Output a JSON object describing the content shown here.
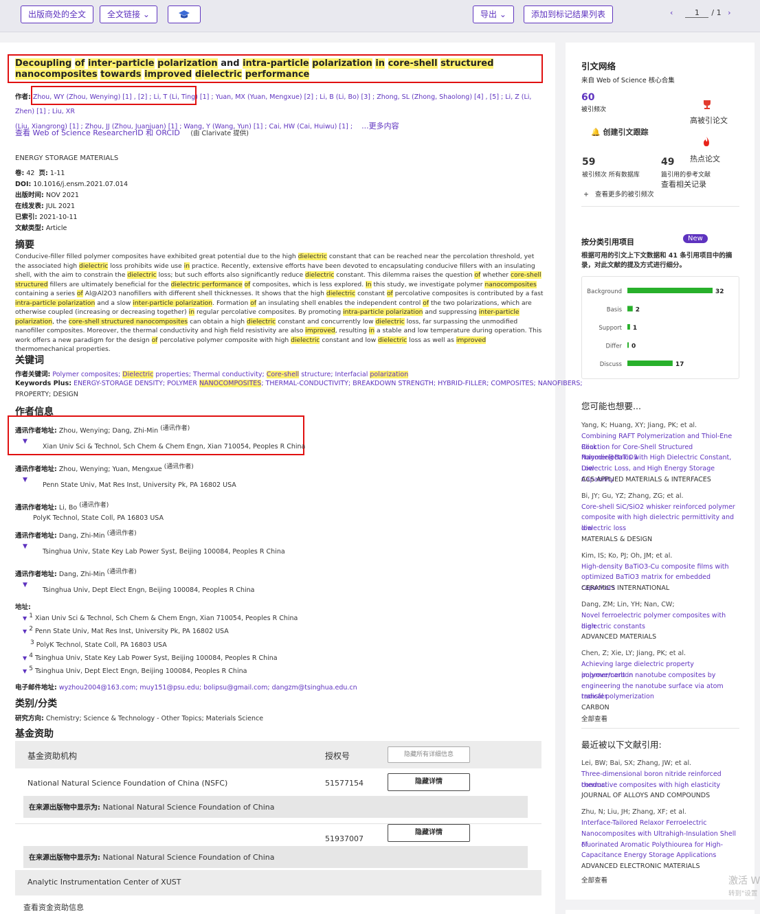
{
  "toolbar": {
    "full_text_label": "出版商处的全文",
    "full_text_links_label": "全文链接",
    "export_label": "导出",
    "add_to_marked_label": "添加到标记结果列表",
    "page_current": "1",
    "page_total": "/ 1"
  },
  "record": {
    "title_segments": [
      {
        "text": "Decoupling",
        "hl": true
      },
      {
        "text": " ",
        "hl": false
      },
      {
        "text": "of",
        "hl": true
      },
      {
        "text": " ",
        "hl": false
      },
      {
        "text": "inter-particle",
        "hl": true
      },
      {
        "text": " ",
        "hl": false
      },
      {
        "text": "polarization",
        "hl": true
      },
      {
        "text": " and ",
        "hl": false
      },
      {
        "text": "intra-particle",
        "hl": true
      },
      {
        "text": " ",
        "hl": false
      },
      {
        "text": "polarization",
        "hl": true
      },
      {
        "text": " ",
        "hl": false
      },
      {
        "text": "in",
        "hl": true
      },
      {
        "text": " ",
        "hl": false
      },
      {
        "text": "core-shell",
        "hl": true
      },
      {
        "text": " ",
        "hl": false
      },
      {
        "text": "structured",
        "hl": true
      },
      {
        "text": " ",
        "hl": false
      },
      {
        "text": "nanocomposites",
        "hl": true
      },
      {
        "text": " ",
        "hl": false
      },
      {
        "text": "towards",
        "hl": true
      },
      {
        "text": " ",
        "hl": false
      },
      {
        "text": "improved",
        "hl": true
      },
      {
        "text": " ",
        "hl": false
      },
      {
        "text": "dielectric",
        "hl": true
      },
      {
        "text": " ",
        "hl": false
      },
      {
        "text": "performance",
        "hl": true
      }
    ],
    "authors_label": "作者:",
    "authors_line1": "Zhou, WY (Zhou, Wenying) [1] , [2] ; Li, T (Li, Ting) [1] ; Yuan, MX (Yuan, Mengxue) [2] ; Li, B (Li, Bo) [3] ; Zhong, SL (Zhong, Shaolong) [4] , [5] ; Li, Z (Li, Zhen) [1] ; Liu, XR",
    "authors_line2": "(Liu, Xiangrong) [1] ; Zhou, JJ (Zhou, Juanjuan) [1] ; Wang, Y (Wang, Yun) [1] ; Cai, HW (Cai, Huiwu) [1] ;",
    "more_label": "...更多内容",
    "researcher_link": "查看 Web of Science ResearcherID 和 ORCID",
    "provider": "(由 Clarivate 提供)",
    "journal": "ENERGY STORAGE MATERIALS",
    "volume_label": "卷:",
    "volume": "42",
    "pages_label": "页:",
    "pages": "1-11",
    "doi_label": "DOI:",
    "doi": "10.1016/j.ensm.2021.07.014",
    "pub_label": "出版时间:",
    "pub": "NOV 2021",
    "online_label": "在线发表:",
    "online": "JUL 2021",
    "indexed_label": "已索引:",
    "indexed": "2021-10-11",
    "doctype_label": "文献类型:",
    "doctype": "Article",
    "abstract_heading": "摘要",
    "abstract_segments": [
      {
        "t": "Conducive-filler filled polymer composites have exhibited great potential due to the high ",
        "h": false
      },
      {
        "t": "dielectric",
        "h": true
      },
      {
        "t": " constant that can be reached near the percolation threshold, yet the associated high ",
        "h": false
      },
      {
        "t": "dielectric",
        "h": true
      },
      {
        "t": " loss prohibits wide use ",
        "h": false
      },
      {
        "t": "in",
        "h": true
      },
      {
        "t": " practice. Recently, extensive efforts have been devoted to encapsulating conducive fillers with an insulating shell, with the aim to constrain the ",
        "h": false
      },
      {
        "t": "dielectric",
        "h": true
      },
      {
        "t": " loss; but such efforts also significantly reduce ",
        "h": false
      },
      {
        "t": "dielectric",
        "h": true
      },
      {
        "t": " constant. This dilemma raises the question ",
        "h": false
      },
      {
        "t": "of",
        "h": true
      },
      {
        "t": " whether ",
        "h": false
      },
      {
        "t": "core-shell structured",
        "h": true
      },
      {
        "t": " fillers are ultimately beneficial for the ",
        "h": false
      },
      {
        "t": "dielectric performance",
        "h": true
      },
      {
        "t": " ",
        "h": false
      },
      {
        "t": "of",
        "h": true
      },
      {
        "t": " composites, which is less explored. ",
        "h": false
      },
      {
        "t": "In",
        "h": true
      },
      {
        "t": " this study, we investigate polymer ",
        "h": false
      },
      {
        "t": "nanocomposites",
        "h": true
      },
      {
        "t": " containing a series ",
        "h": false
      },
      {
        "t": "of",
        "h": true
      },
      {
        "t": " Al@Al2O3 nanofillers with different shell thicknesses. It shows that the high ",
        "h": false
      },
      {
        "t": "dielectric",
        "h": true
      },
      {
        "t": " constant ",
        "h": false
      },
      {
        "t": "of",
        "h": true
      },
      {
        "t": " percolative composites is contributed by a fast ",
        "h": false
      },
      {
        "t": "intra-particle polarization",
        "h": true
      },
      {
        "t": " and a slow ",
        "h": false
      },
      {
        "t": "inter-particle polarization",
        "h": true
      },
      {
        "t": ". Formation ",
        "h": false
      },
      {
        "t": "of",
        "h": true
      },
      {
        "t": " an insulating shell enables the independent control ",
        "h": false
      },
      {
        "t": "of",
        "h": true
      },
      {
        "t": " the two polarizations, which are otherwise coupled (increasing or decreasing together) ",
        "h": false
      },
      {
        "t": "in",
        "h": true
      },
      {
        "t": " regular percolative composites. By promoting ",
        "h": false
      },
      {
        "t": "intra-particle polarization",
        "h": true
      },
      {
        "t": " and suppressing ",
        "h": false
      },
      {
        "t": "inter-particle polarization",
        "h": true
      },
      {
        "t": ", the ",
        "h": false
      },
      {
        "t": "core-shell structured nanocomposites",
        "h": true
      },
      {
        "t": " can obtain a high ",
        "h": false
      },
      {
        "t": "dielectric",
        "h": true
      },
      {
        "t": " constant and concurrently low ",
        "h": false
      },
      {
        "t": "dielectric",
        "h": true
      },
      {
        "t": " loss, far surpassing the unmodified nanofiller composites. Moreover, the thermal conductivity and high field resistivity are also ",
        "h": false
      },
      {
        "t": "improved",
        "h": true
      },
      {
        "t": ", resulting ",
        "h": false
      },
      {
        "t": "in",
        "h": true
      },
      {
        "t": " a stable and low temperature during operation. This work offers a new paradigm for the design ",
        "h": false
      },
      {
        "t": "of",
        "h": true
      },
      {
        "t": " percolative polymer composite with high ",
        "h": false
      },
      {
        "t": "dielectric",
        "h": true
      },
      {
        "t": " constant and low ",
        "h": false
      },
      {
        "t": "dielectric",
        "h": true
      },
      {
        "t": " loss as well as ",
        "h": false
      },
      {
        "t": "improved",
        "h": true
      },
      {
        "t": " thermomechanical properties.",
        "h": false
      }
    ],
    "keywords_heading": "关键词",
    "author_kw_label": "作者关键词:",
    "author_kw_segments": [
      {
        "t": "Polymer composites; ",
        "h": false
      },
      {
        "t": "Dielectric",
        "h": true
      },
      {
        "t": " properties; Thermal conductivity; ",
        "h": false
      },
      {
        "t": "Core-shell",
        "h": true
      },
      {
        "t": " structure; Interfacial ",
        "h": false
      },
      {
        "t": "polarization",
        "h": true
      }
    ],
    "kw_plus_label": "Keywords Plus:",
    "kw_plus_segments": [
      {
        "t": "ENERGY-STORAGE DENSITY; POLYMER ",
        "h": false
      },
      {
        "t": "NANOCOMPOSITES",
        "h": true
      },
      {
        "t": "; THERMAL-CONDUCTIVITY; BREAKDOWN STRENGTH; HYBRID-FILLER; COMPOSITES; NANOFIBERS;",
        "h": false
      }
    ],
    "kw_plus_line2": "PROPERTY; DESIGN",
    "author_info_heading": "作者信息",
    "corr_label": "通讯作者地址:",
    "corr_tag": "(通讯作者)",
    "corr": [
      {
        "names": "Zhou, Wenying; Dang, Zhi-Min",
        "addr": "Xian Univ Sci & Technol, Sch Chem & Chem Engn, Xian 710054, Peoples R China"
      },
      {
        "names": "Zhou, Wenying; Yuan, Mengxue",
        "addr": "Penn State Univ, Mat Res Inst, University Pk, PA 16802 USA"
      },
      {
        "names": "Li, Bo",
        "addr": "PolyK Technol, State Coll, PA 16803 USA"
      },
      {
        "names": "Dang, Zhi-Min",
        "addr": "Tsinghua Univ, State Key Lab Power Syst, Beijing 100084, Peoples R China"
      },
      {
        "names": "Dang, Zhi-Min",
        "addr": "Tsinghua Univ, Dept Elect Engn, Beijing 100084, Peoples R China"
      }
    ],
    "address_label": "地址:",
    "addresses": [
      {
        "n": "1",
        "a": "Xian Univ Sci & Technol, Sch Chem & Chem Engn, Xian 710054, Peoples R China"
      },
      {
        "n": "2",
        "a": "Penn State Univ, Mat Res Inst, University Pk, PA 16802 USA"
      },
      {
        "n": "3",
        "a": "PolyK Technol, State Coll, PA 16803 USA"
      },
      {
        "n": "4",
        "a": "Tsinghua Univ, State Key Lab Power Syst, Beijing 100084, Peoples R China"
      },
      {
        "n": "5",
        "a": "Tsinghua Univ, Dept Elect Engn, Beijing 100084, Peoples R China"
      }
    ],
    "email_label": "电子邮件地址:",
    "emails": "wyzhou2004@163.com; muy151@psu.edu; bolipsu@gmail.com; dangzm@tsinghua.edu.cn",
    "category_heading": "类别/分类",
    "research_label": "研究方向:",
    "research": "Chemistry; Science & Technology - Other Topics; Materials Science",
    "funding_heading": "基金资助",
    "funding": {
      "col_agency": "基金资助机构",
      "col_grant": "授权号",
      "hide_all_label": "隐藏所有详细信息",
      "hide_detail_label": "隐藏详情",
      "display_label": "在来源出版物中显示为:",
      "rows": [
        {
          "agency": "National Natural Science Foundation of China (NSFC)",
          "grant": "51577154",
          "display": "National Natural Science Foundation of China"
        },
        {
          "agency": "",
          "grant": "51937007",
          "display": "National Natural Science Foundation of China"
        }
      ],
      "last_agency": "Analytic Instrumentation Center of XUST",
      "view_funding": "查看资金资助信息"
    }
  },
  "sidebar": {
    "citation_network": "引文网络",
    "from_core": "来自 Web of Science 核心合集",
    "cited_count": "60",
    "cited_label": "被引频次",
    "highly_cited": "高被引论文",
    "create_alert": "创建引文跟踪",
    "hot_paper": "热点论文",
    "all_db_count": "59",
    "all_db_label": "被引频次 所有数据库",
    "refs_count": "49",
    "refs_label": "篇引用的参考文献",
    "view_related": "查看相关记录",
    "more_cited": "查看更多的被引频次",
    "by_class_title": "按分类引用项目",
    "new_badge": "New",
    "by_class_desc": "根据可用的引文上下文数据和 41 条引用项目中的摘录，对此文献的提及方式进行细分。",
    "might_want": "您可能也想要...",
    "suggestions": [
      {
        "authors": "Yang, K; Huang, XY; Jiang, PK; et al.",
        "title": [
          "Combining RAFT Polymerization and Thiol-Ene Click",
          "Reaction for Core-Shell Structured Polymer@BaTiO3",
          "Nanodielectrics with High Dielectric Constant, Low",
          "Dielectric Loss, and High Energy Storage Capability"
        ],
        "journal": "ACS APPLIED MATERIALS & INTERFACES"
      },
      {
        "authors": "Bi, JY; Gu, YZ; Zhang, ZG; et al.",
        "title": [
          "Core-shell SiC/SiO2 whisker reinforced polymer",
          "composite with high dielectric permittivity and low",
          "dielectric loss"
        ],
        "journal": "MATERIALS & DESIGN"
      },
      {
        "authors": "Kim, IS; Ko, PJ; Oh, JM; et al.",
        "title": [
          "High-density BaTiO3-Cu composite films with",
          "optimized BaTiO3 matrix for embedded capacitors"
        ],
        "journal": "CERAMICS INTERNATIONAL"
      },
      {
        "authors": "Dang, ZM; Lin, YH; Nan, CW;",
        "title": [
          "Novel ferroelectric polymer composites with high",
          "dielectric constants"
        ],
        "journal": "ADVANCED MATERIALS"
      },
      {
        "authors": "Chen, Z; Xie, LY; Jiang, PK; et al.",
        "title": [
          "Achieving large dielectric property improvement in",
          "polymer/carbon nanotube composites by",
          "engineering the nanotube surface via atom transfer",
          "radical polymerization"
        ],
        "journal": "CARBON"
      }
    ],
    "view_all": "全部查看",
    "recently_cited": "最近被以下文献引用:",
    "recent": [
      {
        "authors": "Lei, BW; Bai, SX; Zhang, JW; et al.",
        "title": [
          "Three-dimensional boron nitride reinforced thermal",
          "conductive composites with high elasticity"
        ],
        "journal": "JOURNAL OF ALLOYS AND COMPOUNDS"
      },
      {
        "authors": "Zhu, N; Liu, JH; Zhang, XF; et al.",
        "title": [
          "Interface-Tailored Relaxor Ferroelectric",
          "Nanocomposites with Ultrahigh-Insulation Shell of",
          "Fluorinated Aromatic Polythiourea for High-",
          "Capacitance Energy Storage Applications"
        ],
        "journal": "ADVANCED ELECTRONIC MATERIALS"
      }
    ],
    "view_all2": "全部查看",
    "watermark1": "激活 W",
    "watermark2": "转到\"设置"
  },
  "chart_data": {
    "type": "bar",
    "categories": [
      "Background",
      "Basis",
      "Support",
      "Differ",
      "Discuss"
    ],
    "values": [
      32,
      2,
      1,
      0,
      17
    ],
    "title": "",
    "xlabel": "",
    "ylabel": "",
    "colors": [
      "#28b02b"
    ]
  },
  "colors": {
    "accent": "#5e33bf",
    "highlight": "#fff26e",
    "bar": "#28b02b",
    "badge": "#5e33bf",
    "redbox": "#e01010"
  }
}
